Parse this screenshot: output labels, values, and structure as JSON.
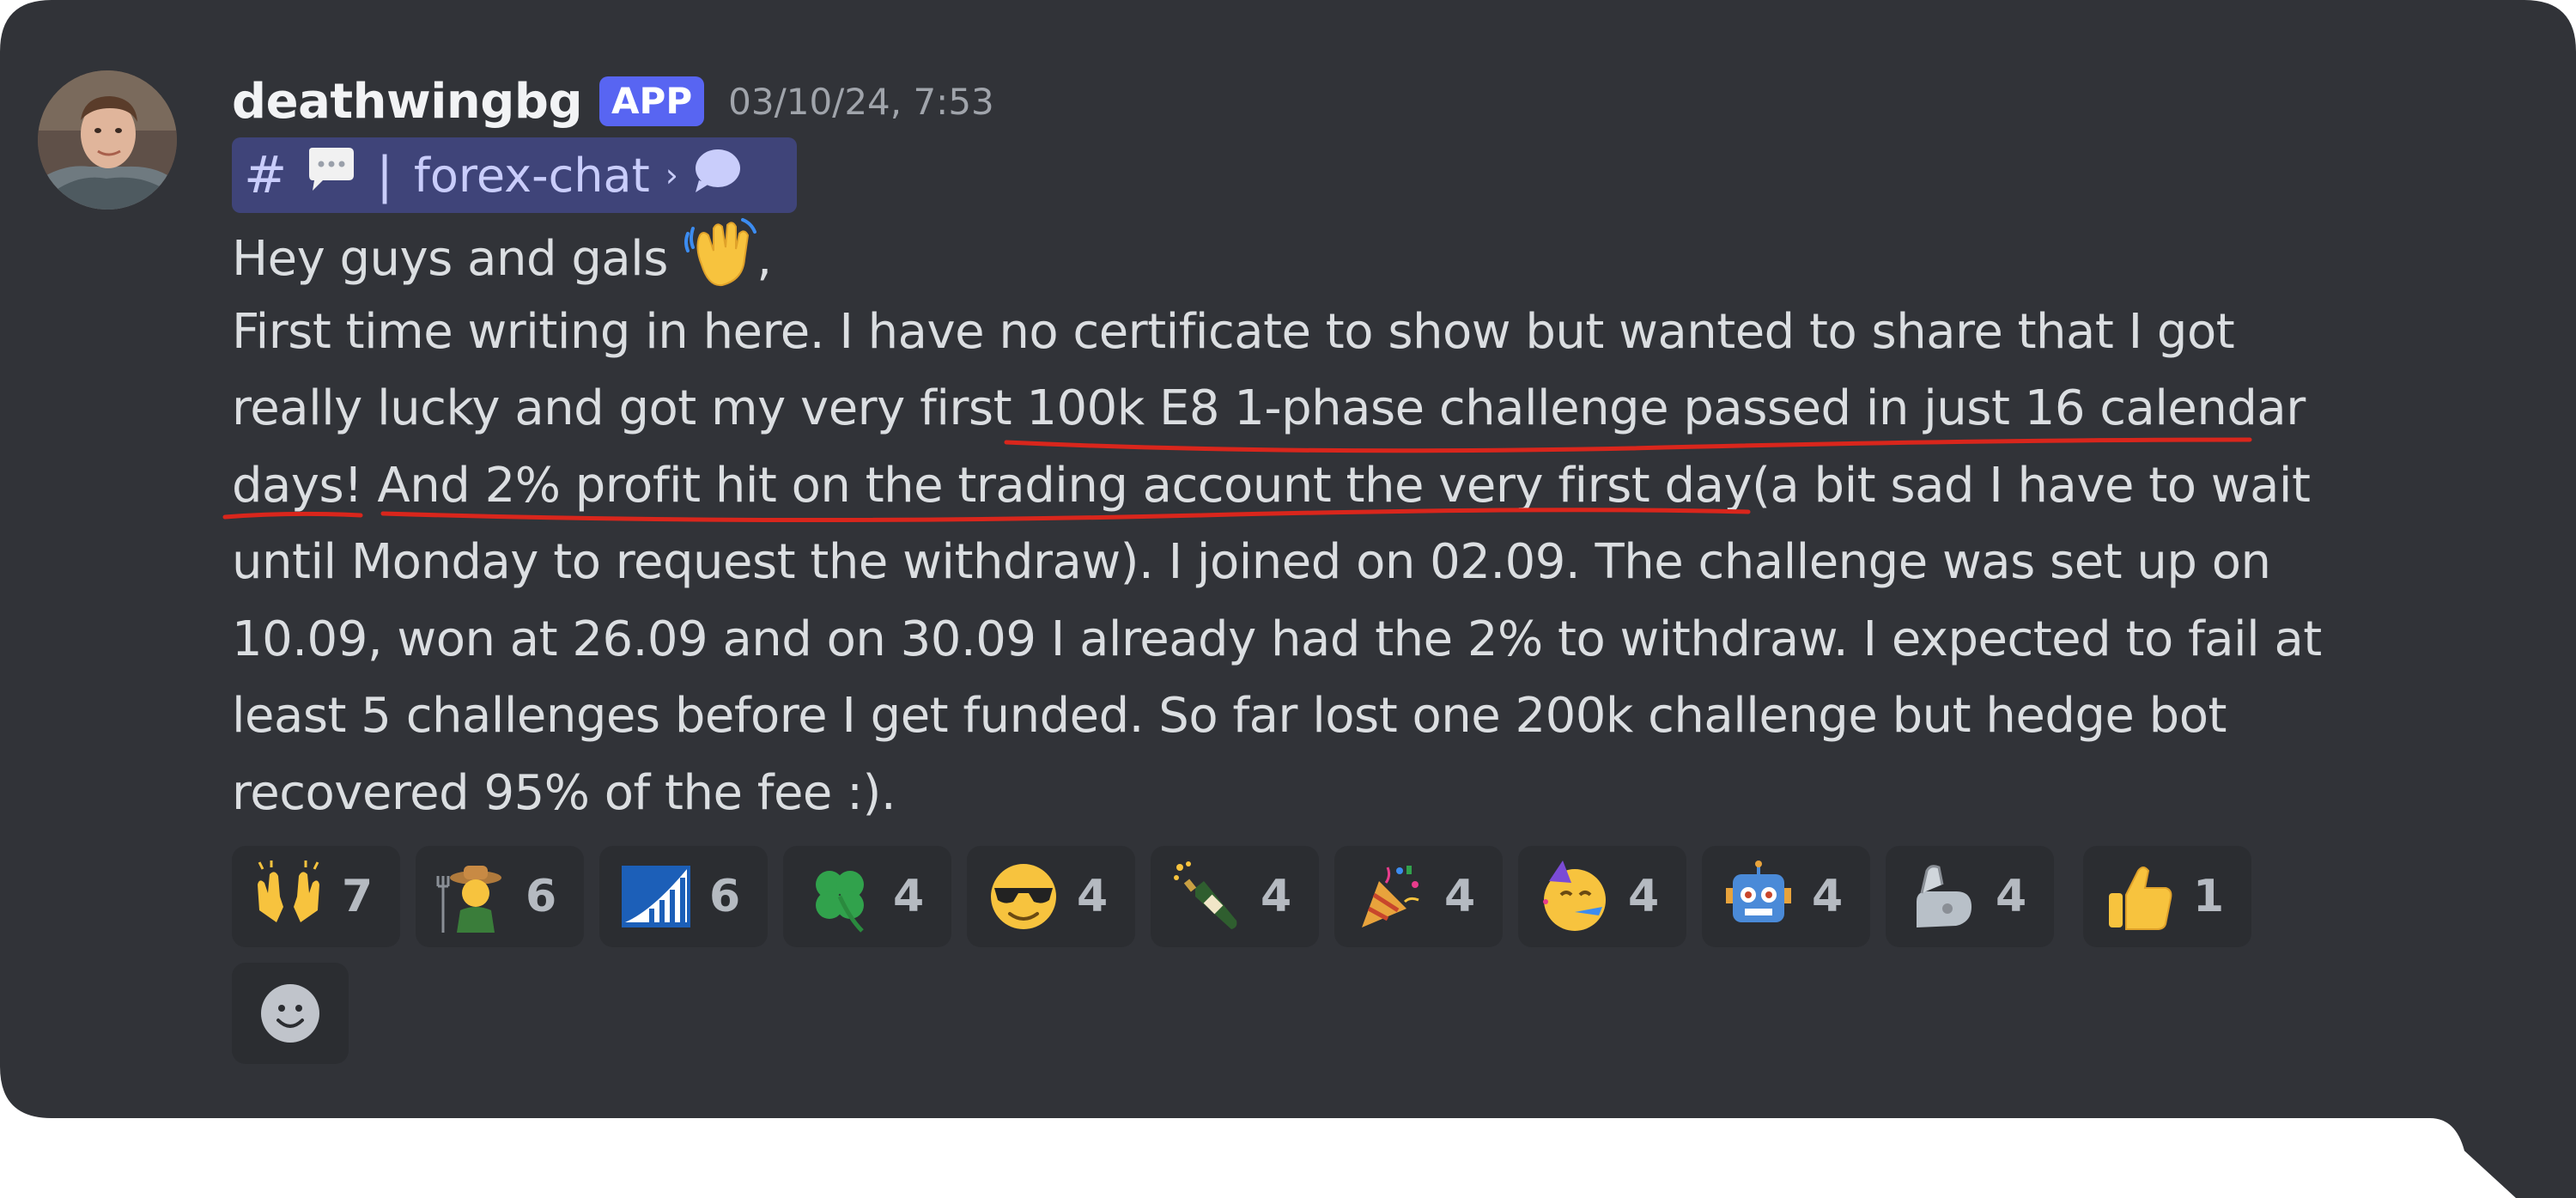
{
  "message": {
    "author": "deathwingbg",
    "badge": "APP",
    "timestamp": "03/10/24, 7:53",
    "channel": {
      "hash": "#",
      "separator": "|",
      "name": "forex-chat",
      "chevron": "›"
    },
    "greeting": "Hey guys and gals",
    "greeting_suffix": ",",
    "body": {
      "l1": "First time writing in here. I have no certificate to show but wanted to share that I got",
      "l2a": "really lucky and got my very first ",
      "l2b": "100k E8 1-phase challenge passed in just  16 calendar",
      "l3a": "days!  And 2% profit hit on the trading account the very first day",
      "l3b": "(a bit sad I have to wait",
      "l4": "until Monday to request the withdraw). I joined on 02.09. The challenge  was set up on",
      "l5": "10.09, won at 26.09 and on 30.09 I already had the 2% to withdraw. I expected to fail at",
      "l6": "least 5 challenges before I get funded. So far lost one 200k challenge but hedge bot",
      "l7": "recovered 95% of the fee :)."
    }
  },
  "reactions": [
    {
      "icon": "raising-hands-icon",
      "count": "7"
    },
    {
      "icon": "farmer-icon",
      "count": "6"
    },
    {
      "icon": "chart-logo-icon",
      "count": "6"
    },
    {
      "icon": "four-leaf-clover-icon",
      "count": "4"
    },
    {
      "icon": "sunglasses-face-icon",
      "count": "4"
    },
    {
      "icon": "champagne-icon",
      "count": "4"
    },
    {
      "icon": "party-popper-icon",
      "count": "4"
    },
    {
      "icon": "partying-face-icon",
      "count": "4"
    },
    {
      "icon": "robot-icon",
      "count": "4"
    },
    {
      "icon": "mechanical-arm-icon",
      "count": "4"
    },
    {
      "icon": "thumbs-up-icon",
      "count": "1"
    }
  ],
  "add_reaction_icon": "add-reaction-icon",
  "colors": {
    "bubble_bg": "#313338",
    "text": "#dbdee1",
    "username": "#f2f3f5",
    "timestamp": "#a0a4ab",
    "badge": "#5865f2",
    "channel_pill": "#3f4479",
    "reaction_bg": "#2b2d31",
    "underline": "#d9261c"
  }
}
